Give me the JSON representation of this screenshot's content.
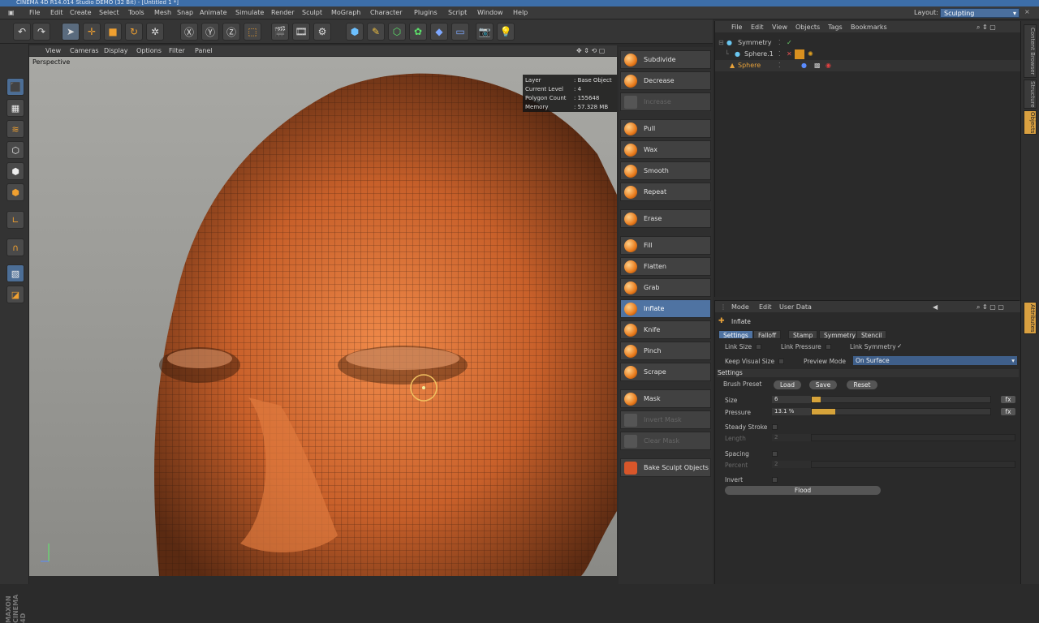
{
  "titlebar": {
    "text": "CINEMA 4D R14.014 Studio DEMO (32 Bit) - [Untitled 1 *]"
  },
  "menubar": {
    "items": [
      "File",
      "Edit",
      "Create",
      "Select",
      "Tools",
      "Mesh",
      "Snap",
      "Animate",
      "Simulate",
      "Render",
      "Sculpt",
      "MoGraph",
      "Character",
      "Plugins",
      "Script",
      "Window",
      "Help"
    ],
    "layout_label": "Layout:",
    "layout_value": "Sculpting"
  },
  "viewport": {
    "menu": [
      "View",
      "Cameras",
      "Display",
      "Options",
      "Filter",
      "Panel"
    ],
    "name": "Perspective",
    "hud": [
      {
        "k": "Layer",
        "v": ": Base Object"
      },
      {
        "k": "Current Level",
        "v": ": 4"
      },
      {
        "k": "Polygon Count",
        "v": ": 155648"
      },
      {
        "k": "Memory",
        "v": ": 57.328 MB"
      }
    ]
  },
  "brushes": [
    {
      "label": "Subdivide",
      "enabled": true
    },
    {
      "label": "Decrease",
      "enabled": true
    },
    {
      "label": "Increase",
      "enabled": false
    },
    {
      "label": "Pull",
      "enabled": true
    },
    {
      "label": "Wax",
      "enabled": true
    },
    {
      "label": "Smooth",
      "enabled": true
    },
    {
      "label": "Repeat",
      "enabled": true
    },
    {
      "label": "Erase",
      "enabled": true
    },
    {
      "label": "Fill",
      "enabled": true
    },
    {
      "label": "Flatten",
      "enabled": true
    },
    {
      "label": "Grab",
      "enabled": true
    },
    {
      "label": "Inflate",
      "enabled": true,
      "selected": true
    },
    {
      "label": "Knife",
      "enabled": true
    },
    {
      "label": "Pinch",
      "enabled": true
    },
    {
      "label": "Scrape",
      "enabled": true
    },
    {
      "label": "Mask",
      "enabled": true
    },
    {
      "label": "Invert Mask",
      "enabled": false
    },
    {
      "label": "Clear Mask",
      "enabled": false
    },
    {
      "label": "Bake Sculpt Objects",
      "enabled": true
    }
  ],
  "object_manager": {
    "menu": [
      "File",
      "Edit",
      "View",
      "Objects",
      "Tags",
      "Bookmarks"
    ],
    "objects": [
      {
        "name": "Symmetry",
        "color": "#c8c8c8"
      },
      {
        "name": "Sphere.1",
        "color": "#c8c8c8"
      },
      {
        "name": "Sphere",
        "color": "#e8a23a"
      }
    ]
  },
  "attributes": {
    "menu": [
      "Mode",
      "Edit",
      "User Data"
    ],
    "tool_name": "Inflate",
    "tabs": [
      "Settings",
      "Falloff",
      "Stamp",
      "Symmetry",
      "Stencil"
    ],
    "link_size": "Link Size",
    "link_pressure": "Link Pressure",
    "link_symmetry": "Link Symmetry",
    "link_symmetry_check": "✓",
    "keep_visual_size": "Keep Visual Size",
    "preview_mode_label": "Preview Mode",
    "preview_mode_value": "On Surface",
    "section_settings": "Settings",
    "brush_preset": "Brush Preset",
    "load": "Load",
    "save": "Save",
    "reset": "Reset",
    "size_label": "Size",
    "size_value": "6",
    "size_fill": 0.05,
    "pressure_label": "Pressure",
    "pressure_value": "13.1 %",
    "pressure_fill": 0.131,
    "steady_stroke": "Steady Stroke",
    "length_label": "Length",
    "length_value": "2",
    "spacing_label": "Spacing",
    "percent_label": "Percent",
    "percent_value": "2",
    "invert_label": "Invert",
    "flood": "Flood",
    "fx": "fx"
  },
  "right_tabs": [
    "Content Browser",
    "Structure",
    "Objects",
    "Attributes"
  ],
  "logo": {
    "text": "MAXON CINEMA 4D"
  },
  "colors": {
    "accent": "#4f73a2",
    "layout_bg": "#4a6f9e",
    "sphere_icon": "#e8a23a"
  }
}
